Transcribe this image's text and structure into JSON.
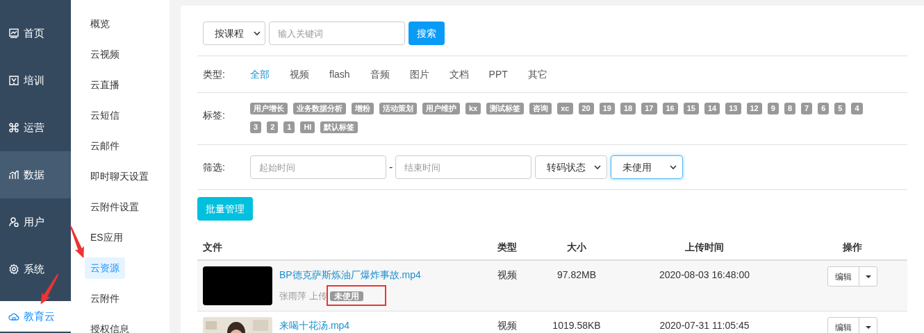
{
  "nav": {
    "items": [
      {
        "label": "首页",
        "selected": false,
        "hovered": false
      },
      {
        "label": "培训",
        "selected": false,
        "hovered": false
      },
      {
        "label": "运营",
        "selected": false,
        "hovered": false
      },
      {
        "label": "数据",
        "selected": false,
        "hovered": true
      },
      {
        "label": "用户",
        "selected": false,
        "hovered": false
      },
      {
        "label": "系统",
        "selected": false,
        "hovered": false
      },
      {
        "label": "教育云",
        "selected": true,
        "hovered": false
      }
    ]
  },
  "annotations": [
    {
      "kind": "arrow"
    },
    {
      "kind": "arrow"
    }
  ],
  "submenu": {
    "items": [
      {
        "label": "概览",
        "selected": false
      },
      {
        "label": "云视频",
        "selected": false
      },
      {
        "label": "云直播",
        "selected": false
      },
      {
        "label": "云短信",
        "selected": false
      },
      {
        "label": "云邮件",
        "selected": false
      },
      {
        "label": "即时聊天设置",
        "selected": false
      },
      {
        "label": "云附件设置",
        "selected": false
      },
      {
        "label": "ES应用",
        "selected": false
      },
      {
        "label": "云资源",
        "selected": true
      },
      {
        "label": "云附件",
        "selected": false
      },
      {
        "label": "授权信息",
        "selected": false
      }
    ]
  },
  "search": {
    "scope": "按课程",
    "placeholder": "输入关键词",
    "button": "搜索"
  },
  "type_filter": {
    "label": "类型:",
    "options": [
      {
        "label": "全部",
        "selected": true
      },
      {
        "label": "视频",
        "selected": false
      },
      {
        "label": "flash",
        "selected": false
      },
      {
        "label": "音频",
        "selected": false
      },
      {
        "label": "图片",
        "selected": false
      },
      {
        "label": "文档",
        "selected": false
      },
      {
        "label": "PPT",
        "selected": false
      },
      {
        "label": "其它",
        "selected": false
      }
    ]
  },
  "tag_filter": {
    "label": "标签:",
    "tags": [
      "用户增长",
      "业务数据分析",
      "增粉",
      "活动策划",
      "用户维护",
      "kx",
      "测试标签",
      "咨询",
      "xc",
      "20",
      "19",
      "18",
      "17",
      "16",
      "15",
      "14",
      "13",
      "12",
      "9",
      "8",
      "7",
      "6",
      "5",
      "4",
      "3",
      "2",
      "1",
      "HI",
      "默认标签"
    ]
  },
  "screen_filter": {
    "label": "筛选:",
    "start_placeholder": "起始时间",
    "separator": "-",
    "end_placeholder": "结束时间",
    "transcode": {
      "value": "转码状态",
      "focused": false
    },
    "usage": {
      "value": "未使用",
      "focused": true
    }
  },
  "batch_button": "批量管理",
  "table": {
    "columns": [
      "文件",
      "类型",
      "大小",
      "上传时间",
      "操作"
    ],
    "rows": [
      {
        "kind": "blank",
        "name": "BP德克萨斯炼油厂爆炸事故.mp4",
        "uploader": "张雨萍 上传",
        "status": "未使用",
        "status_highlighted": true,
        "type": "视频",
        "size": "97.82MB",
        "time": "2020-08-03 16:48:00",
        "action": "编辑"
      },
      {
        "kind": "picture",
        "name": "来喝十花汤.mp4",
        "type": "视频",
        "size": "1019.58KB",
        "time": "2020-07-31 11:05:45",
        "action": "编辑"
      }
    ]
  }
}
